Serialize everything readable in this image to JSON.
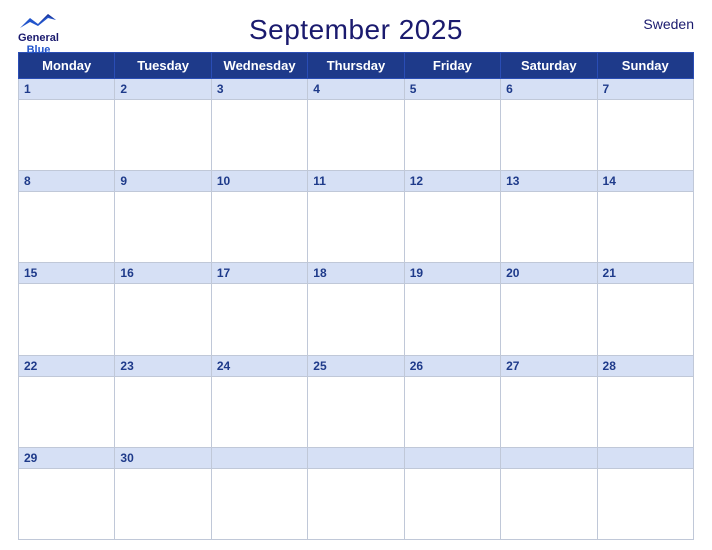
{
  "header": {
    "title": "September 2025",
    "country": "Sweden",
    "logo": {
      "line1": "General",
      "line2": "Blue"
    }
  },
  "weekdays": [
    "Monday",
    "Tuesday",
    "Wednesday",
    "Thursday",
    "Friday",
    "Saturday",
    "Sunday"
  ],
  "weeks": [
    [
      1,
      2,
      3,
      4,
      5,
      6,
      7
    ],
    [
      8,
      9,
      10,
      11,
      12,
      13,
      14
    ],
    [
      15,
      16,
      17,
      18,
      19,
      20,
      21
    ],
    [
      22,
      23,
      24,
      25,
      26,
      27,
      28
    ],
    [
      29,
      30,
      null,
      null,
      null,
      null,
      null
    ]
  ]
}
